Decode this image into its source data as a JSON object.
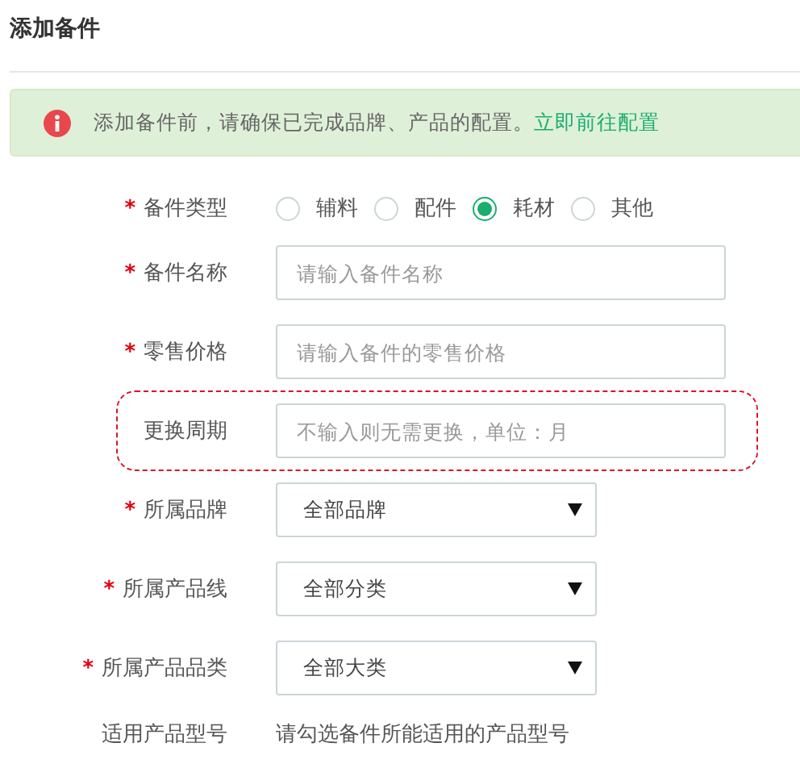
{
  "page": {
    "title": "添加备件"
  },
  "notice": {
    "text": "添加备件前，请确保已完成品牌、产品的配置。",
    "link": "立即前往配置"
  },
  "form": {
    "rows": [
      {
        "kind": "radio",
        "label": "备件类型",
        "required_mark": "*",
        "options": [
          {
            "label": "辅料",
            "selected": false
          },
          {
            "label": "配件",
            "selected": false
          },
          {
            "label": "耗材",
            "selected": true
          },
          {
            "label": "其他",
            "selected": false
          }
        ]
      },
      {
        "kind": "input",
        "label": "备件名称",
        "required_mark": "*",
        "placeholder": "请输入备件名称",
        "highlighted": false
      },
      {
        "kind": "input",
        "label": "零售价格",
        "required_mark": "*",
        "placeholder": "请输入备件的零售价格",
        "highlighted": false
      },
      {
        "kind": "input",
        "label": "更换周期",
        "placeholder": "不输入则无需更换，单位：月",
        "highlighted": true
      },
      {
        "kind": "select",
        "label": "所属品牌",
        "required_mark": "*",
        "value": "全部品牌"
      },
      {
        "kind": "select",
        "label": "所属产品线",
        "required_mark": "*",
        "value": "全部分类"
      },
      {
        "kind": "select",
        "label": "所属产品品类",
        "required_mark": "*",
        "value": "全部大类"
      },
      {
        "kind": "note",
        "label": "适用产品型号",
        "text": "请勾选备件所能适用的产品型号"
      }
    ]
  }
}
